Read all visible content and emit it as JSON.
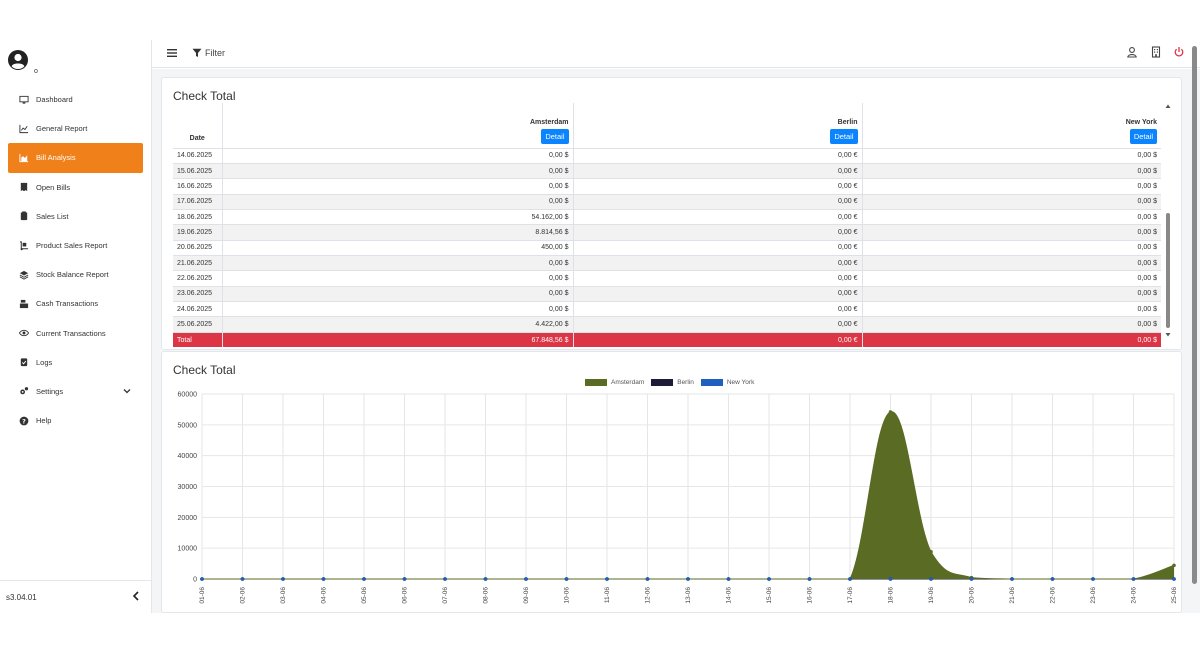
{
  "user": {
    "name": "o"
  },
  "sidebar": {
    "items": [
      {
        "label": "Dashboard",
        "icon": "monitor-icon"
      },
      {
        "label": "General Report",
        "icon": "line-chart-icon"
      },
      {
        "label": "Bill Analysis",
        "icon": "area-chart-icon",
        "active": true
      },
      {
        "label": "Open Bills",
        "icon": "receipt-icon"
      },
      {
        "label": "Sales List",
        "icon": "clipboard-icon"
      },
      {
        "label": "Product Sales Report",
        "icon": "dolly-icon"
      },
      {
        "label": "Stock Balance Report",
        "icon": "layers-icon"
      },
      {
        "label": "Cash Transactions",
        "icon": "cash-register-icon"
      },
      {
        "label": "Current Transactions",
        "icon": "eye-icon"
      },
      {
        "label": "Logs",
        "icon": "clipboard-check-icon"
      },
      {
        "label": "Settings",
        "icon": "gears-icon"
      },
      {
        "label": "Help",
        "icon": "question-circle-icon"
      }
    ],
    "version": "s3.04.01"
  },
  "topbar": {
    "filter_label": "Filter"
  },
  "table_card": {
    "title": "Check Total",
    "date_header": "Date",
    "detail_label": "Detail",
    "columns": [
      "Amsterdam",
      "Berlin",
      "New York"
    ],
    "rows": [
      [
        "14.06.2025",
        "0,00 $",
        "0,00 €",
        "0,00 $"
      ],
      [
        "15.06.2025",
        "0,00 $",
        "0,00 €",
        "0,00 $"
      ],
      [
        "16.06.2025",
        "0,00 $",
        "0,00 €",
        "0,00 $"
      ],
      [
        "17.06.2025",
        "0,00 $",
        "0,00 €",
        "0,00 $"
      ],
      [
        "18.06.2025",
        "54.162,00 $",
        "0,00 €",
        "0,00 $"
      ],
      [
        "19.06.2025",
        "8.814,56 $",
        "0,00 €",
        "0,00 $"
      ],
      [
        "20.06.2025",
        "450,00 $",
        "0,00 €",
        "0,00 $"
      ],
      [
        "21.06.2025",
        "0,00 $",
        "0,00 €",
        "0,00 $"
      ],
      [
        "22.06.2025",
        "0,00 $",
        "0,00 €",
        "0,00 $"
      ],
      [
        "23.06.2025",
        "0,00 $",
        "0,00 €",
        "0,00 $"
      ],
      [
        "24.06.2025",
        "0,00 $",
        "0,00 €",
        "0,00 $"
      ],
      [
        "25.06.2025",
        "4.422,00 $",
        "0,00 €",
        "0,00 $"
      ]
    ],
    "total": [
      "Total",
      "67.848,56 $",
      "0,00 €",
      "0,00 $"
    ]
  },
  "chart_card": {
    "title": "Check Total"
  },
  "chart_data": {
    "type": "area",
    "title": "",
    "xlabel": "",
    "ylabel": "",
    "ylim": [
      0,
      60000
    ],
    "yticks": [
      0,
      10000,
      20000,
      30000,
      40000,
      50000,
      60000
    ],
    "grid": true,
    "legend_position": "top-center",
    "x": [
      "01-06",
      "02-06",
      "03-06",
      "04-06",
      "05-06",
      "06-06",
      "07-06",
      "08-06",
      "09-06",
      "10-06",
      "11-06",
      "12-06",
      "13-06",
      "14-06",
      "15-06",
      "16-06",
      "17-06",
      "18-06",
      "19-06",
      "20-06",
      "21-06",
      "22-06",
      "23-06",
      "24-06",
      "25-06"
    ],
    "series": [
      {
        "name": "Amsterdam",
        "color": "#5a6b24",
        "values": [
          0,
          0,
          0,
          0,
          0,
          0,
          0,
          0,
          0,
          0,
          0,
          0,
          0,
          0,
          0,
          0,
          0,
          54162,
          8814.56,
          450,
          0,
          0,
          0,
          0,
          4422
        ]
      },
      {
        "name": "Berlin",
        "color": "#1c1c38",
        "values": [
          0,
          0,
          0,
          0,
          0,
          0,
          0,
          0,
          0,
          0,
          0,
          0,
          0,
          0,
          0,
          0,
          0,
          0,
          0,
          0,
          0,
          0,
          0,
          0,
          0
        ]
      },
      {
        "name": "New York",
        "color": "#1f5fbf",
        "values": [
          0,
          0,
          0,
          0,
          0,
          0,
          0,
          0,
          0,
          0,
          0,
          0,
          0,
          0,
          0,
          0,
          0,
          0,
          0,
          0,
          0,
          0,
          0,
          0,
          0
        ]
      }
    ]
  },
  "colors": {
    "accent": "#f0811a",
    "total_row": "#dc3545",
    "button": "#0a84ff",
    "power": "#dc3545"
  }
}
